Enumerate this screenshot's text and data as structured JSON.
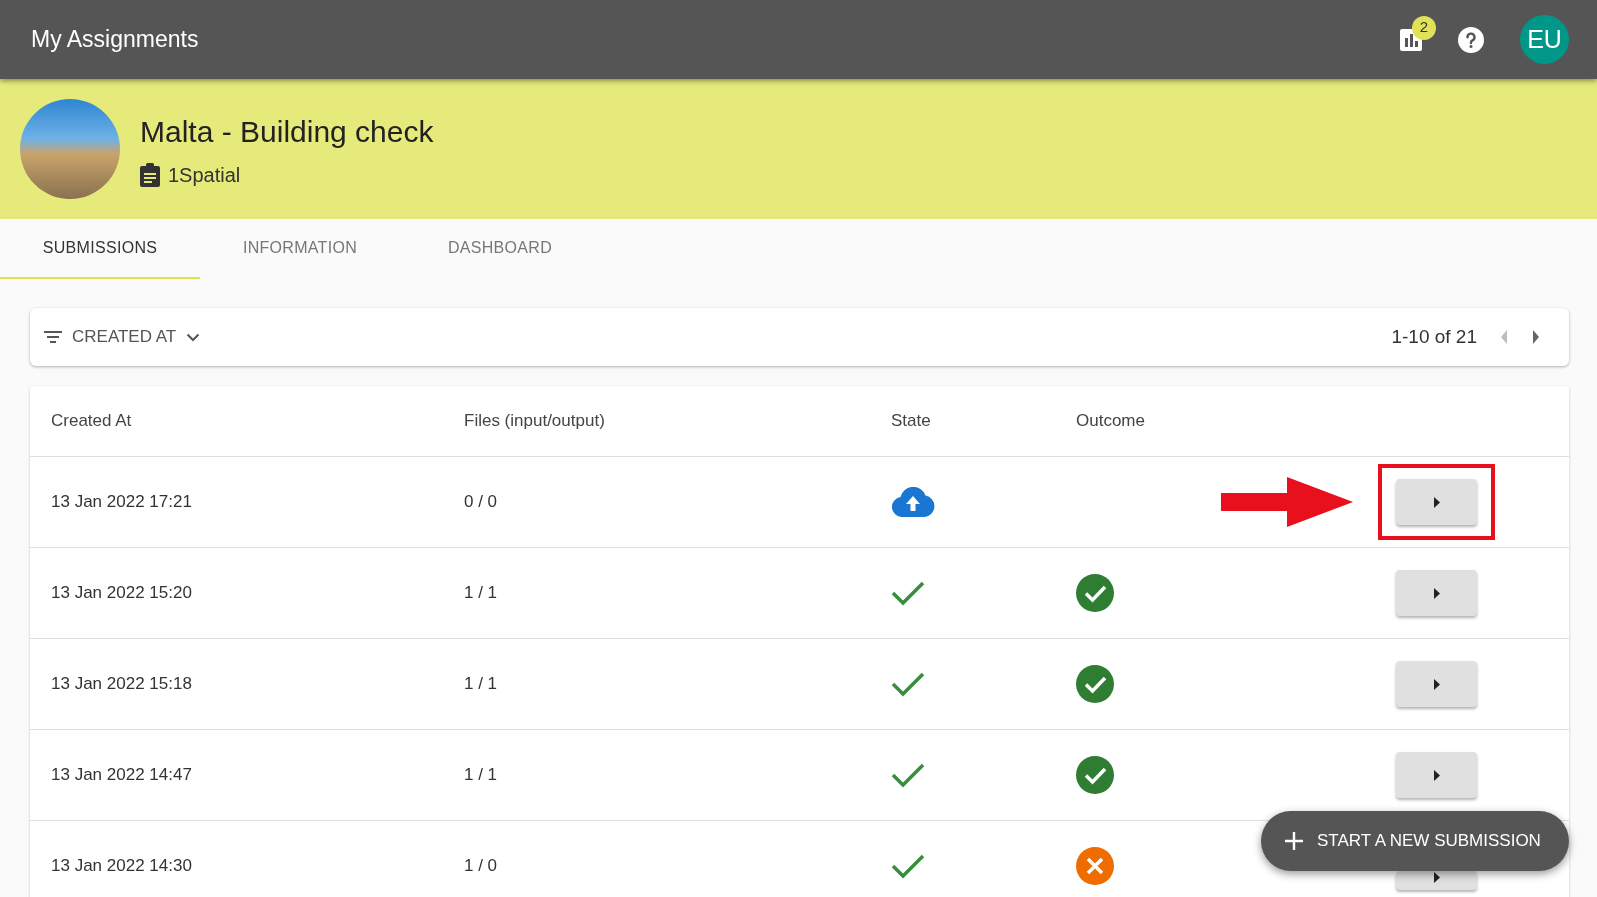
{
  "app_bar": {
    "title": "My Assignments",
    "notifications_badge": "2",
    "avatar_initials": "EU"
  },
  "assignment": {
    "title": "Malta - Building check",
    "organisation": "1Spatial"
  },
  "tabs": [
    {
      "label": "SUBMISSIONS",
      "selected": true
    },
    {
      "label": "INFORMATION",
      "selected": false
    },
    {
      "label": "DASHBOARD",
      "selected": false
    }
  ],
  "toolbar": {
    "sort_label": "CREATED AT",
    "range": "1-10 of 21",
    "previous": {
      "disabled": true
    },
    "next": {
      "disabled": false
    }
  },
  "table": {
    "columns": [
      "Created At",
      "Files (input/output)",
      "State",
      "Outcome"
    ],
    "rows": [
      {
        "created_at": "13 Jan 2022 17:21",
        "files": "0 / 0",
        "state": {
          "kind": "uploading"
        },
        "highlighted": true
      },
      {
        "created_at": "13 Jan 2022 15:20",
        "files": "1 / 1",
        "state": {
          "kind": "processed"
        },
        "outcome": {
          "kind": "passed"
        },
        "highlighted": false
      },
      {
        "created_at": "13 Jan 2022 15:18",
        "files": "1 / 1",
        "state": {
          "kind": "processed"
        },
        "outcome": {
          "kind": "passed"
        },
        "highlighted": false
      },
      {
        "created_at": "13 Jan 2022 14:47",
        "files": "1 / 1",
        "state": {
          "kind": "processed"
        },
        "outcome": {
          "kind": "passed"
        },
        "highlighted": false
      },
      {
        "created_at": "13 Jan 2022 14:30",
        "files": "1 / 0",
        "state": {
          "kind": "processed"
        },
        "outcome": {
          "kind": "failed"
        },
        "highlighted": false
      }
    ]
  },
  "fab": {
    "label": "START A NEW SUBMISSION"
  }
}
